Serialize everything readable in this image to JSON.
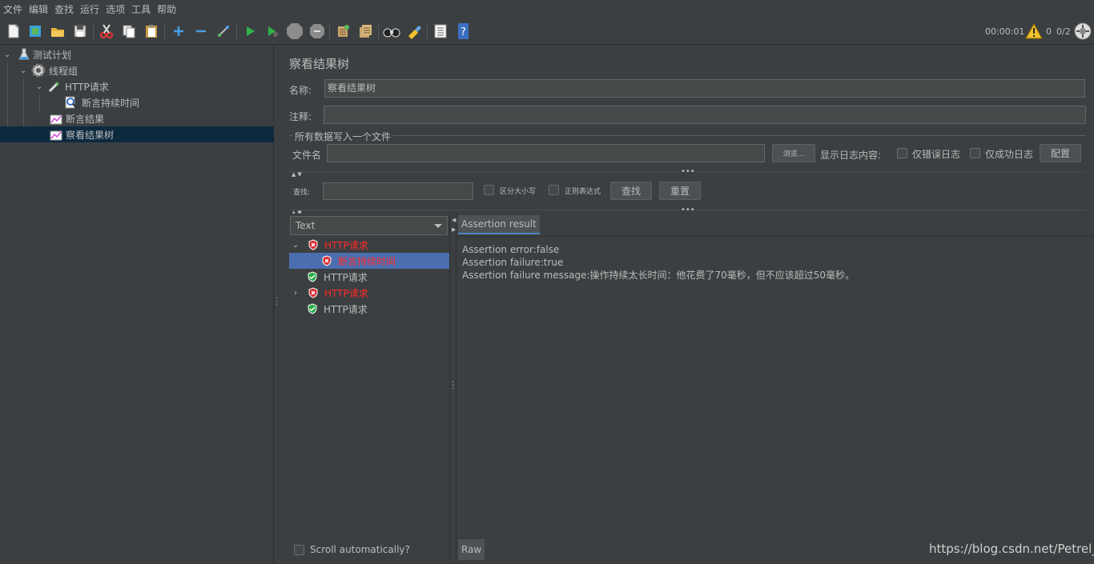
{
  "menu": [
    "文件",
    "编辑",
    "查找",
    "运行",
    "选项",
    "工具",
    "帮助"
  ],
  "toolbar": {
    "icons": [
      "new-file-icon",
      "templates-icon",
      "open-icon",
      "save-icon",
      "cut-icon",
      "copy-icon",
      "paste-icon",
      "expand-icon",
      "collapse-icon",
      "toggle-icon",
      "start-icon",
      "start-no-pause-icon",
      "stop-icon",
      "shutdown-icon",
      "clear-icon",
      "clear-all-icon",
      "search-icon",
      "reset-search-icon",
      "function-helper-icon",
      "help-icon"
    ],
    "elapsed": "00:00:01",
    "warnings": "0",
    "threads": "0/2"
  },
  "tree": {
    "items": [
      {
        "label": "测试计划",
        "icon": "test-plan-icon"
      },
      {
        "label": "线程组",
        "icon": "thread-group-icon"
      },
      {
        "label": "HTTP请求",
        "icon": "http-sampler-icon"
      },
      {
        "label": "断言持续时间",
        "icon": "duration-assertion-icon"
      },
      {
        "label": "断言结果",
        "icon": "listener-icon"
      },
      {
        "label": "察看结果树",
        "icon": "listener-icon"
      }
    ]
  },
  "panel": {
    "title": "察看结果树",
    "name_label": "名称:",
    "name_value": "察看结果树",
    "comment_label": "注释:",
    "comment_value": "",
    "file_group_title": "所有数据写入一个文件",
    "filename_label": "文件名",
    "filename_value": "",
    "browse_label": "浏览...",
    "log_contents_label": "显示日志内容:",
    "errors_only_label": "仅错误日志",
    "success_only_label": "仅成功日志",
    "configure_label": "配置",
    "search_label": "查找:",
    "search_value": "",
    "case_sensitive_label": "区分大小写",
    "regex_label": "正则表达式",
    "find_button": "查找",
    "reset_button": "重置"
  },
  "results": {
    "renderer": "Text",
    "rows": [
      {
        "label": "HTTP请求",
        "status": "fail"
      },
      {
        "label": "断言持续时间",
        "status": "fail"
      },
      {
        "label": "HTTP请求",
        "status": "pass"
      },
      {
        "label": "HTTP请求",
        "status": "fail"
      },
      {
        "label": "HTTP请求",
        "status": "pass"
      }
    ],
    "tab_label": "Assertion result",
    "lines": [
      "Assertion error:false",
      "Assertion failure:true",
      "Assertion failure message:操作持续太长时间：他花费了70毫秒，但不应该超过50毫秒。"
    ],
    "raw_tab": "Raw",
    "scroll_auto_label": "Scroll automatically?"
  },
  "watermark": "https://blog.csdn.net/Petrel_",
  "colors": {
    "fail": "#ff2a2a",
    "selection": "#4b6eaf",
    "tree_selection": "#0d293e"
  }
}
